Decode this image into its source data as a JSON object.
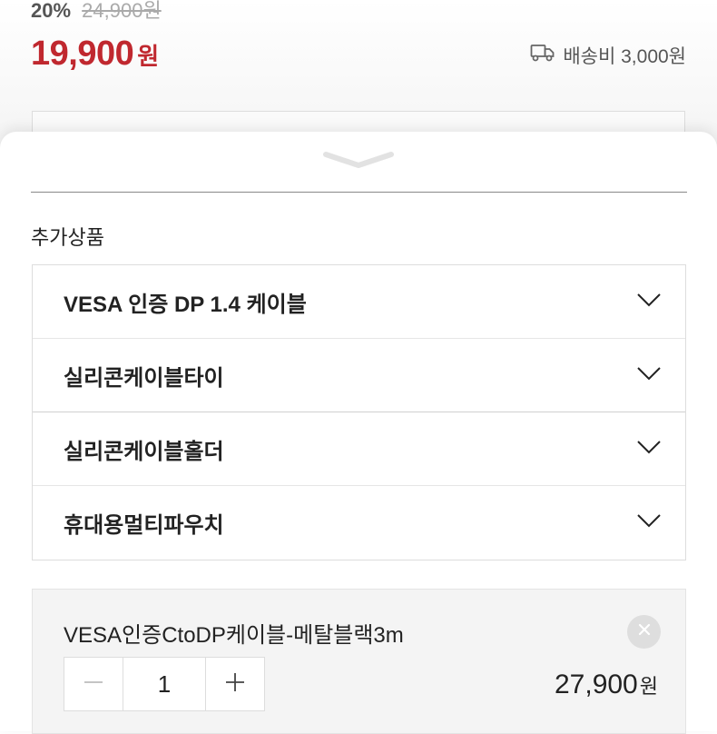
{
  "product": {
    "discount_percent": "20%",
    "original_price": "24,900원",
    "sale_price": "19,900",
    "currency_unit": "원",
    "shipping_text": "배송비 3,000원",
    "shipping_icon": "truck-icon"
  },
  "sheet": {
    "section_label": "추가상품",
    "options": [
      {
        "label": "VESA 인증 DP 1.4 케이블"
      },
      {
        "label": "실리콘케이블타이"
      },
      {
        "label": "실리콘케이블홀더"
      },
      {
        "label": "휴대용멀티파우치"
      }
    ]
  },
  "selected_item": {
    "name": "VESA인증CtoDP케이블-메탈블랙3m",
    "quantity": "1",
    "price": "27,900",
    "price_unit": "원"
  },
  "colors": {
    "accent": "#c0282f",
    "border": "#dddddd"
  }
}
